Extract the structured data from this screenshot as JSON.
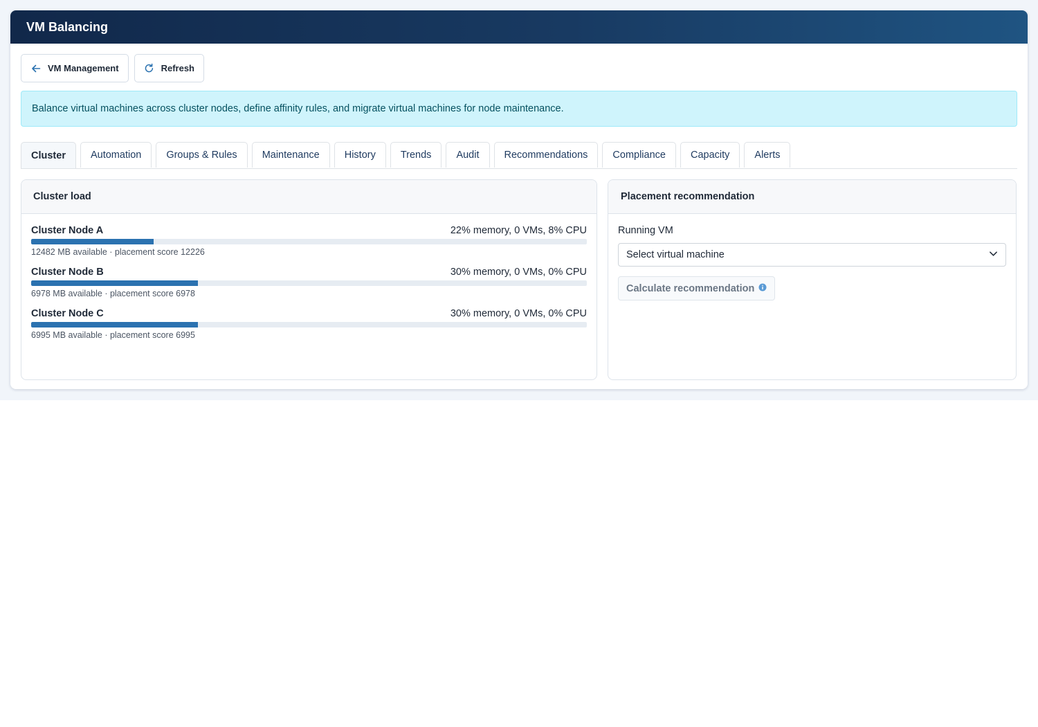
{
  "window": {
    "title": "VM Balancing"
  },
  "toolbar": {
    "back_label": "VM Management",
    "back_icon": "arrow-left-icon",
    "refresh_label": "Refresh",
    "refresh_icon": "refresh-icon"
  },
  "info_banner": {
    "text": "Balance virtual machines across cluster nodes, define affinity rules, and migrate virtual machines for node maintenance."
  },
  "tabs": [
    {
      "label": "Cluster",
      "active": true
    },
    {
      "label": "Automation",
      "active": false
    },
    {
      "label": "Groups & Rules",
      "active": false
    },
    {
      "label": "Maintenance",
      "active": false
    },
    {
      "label": "History",
      "active": false
    },
    {
      "label": "Trends",
      "active": false
    },
    {
      "label": "Audit",
      "active": false
    },
    {
      "label": "Recommendations",
      "active": false
    },
    {
      "label": "Compliance",
      "active": false
    },
    {
      "label": "Capacity",
      "active": false
    },
    {
      "label": "Alerts",
      "active": false
    }
  ],
  "cluster_load": {
    "title": "Cluster load",
    "nodes": [
      {
        "name": "Cluster Node A",
        "stats": "22% memory, 0 VMs, 8% CPU",
        "memory_percent": 22,
        "detail": "12482 MB available · placement score 12226"
      },
      {
        "name": "Cluster Node B",
        "stats": "30% memory, 0 VMs, 0% CPU",
        "memory_percent": 30,
        "detail": "6978 MB available · placement score 6978"
      },
      {
        "name": "Cluster Node C",
        "stats": "30% memory, 0 VMs, 0% CPU",
        "memory_percent": 30,
        "detail": "6995 MB available · placement score 6995"
      }
    ]
  },
  "placement": {
    "title": "Placement recommendation",
    "field_label": "Running VM",
    "select_value": "Select virtual machine",
    "select_icon": "chevron-down-icon",
    "calc_label": "Calculate recommendation",
    "calc_icon": "info-icon"
  },
  "colors": {
    "accent": "#2b72b0",
    "header_start": "#11284a",
    "header_end": "#1f5482",
    "info_bg": "#cff4fc",
    "info_text": "#055160"
  }
}
